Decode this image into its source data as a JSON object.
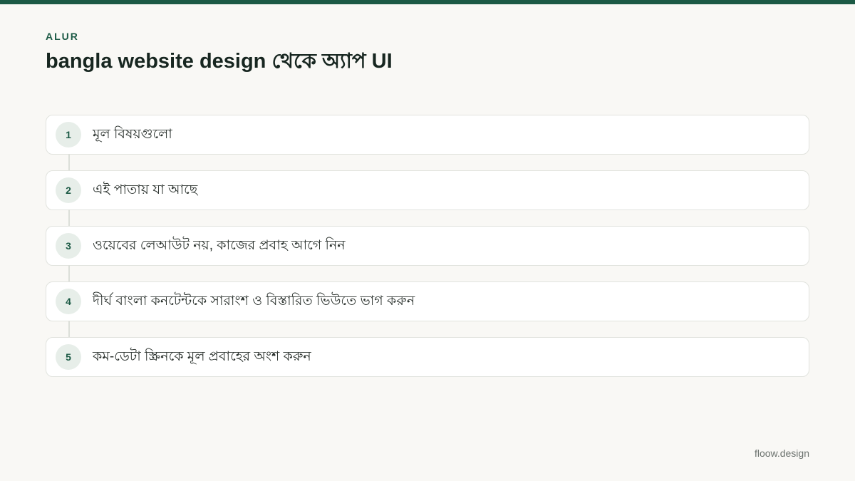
{
  "header": {
    "eyebrow": "ALUR",
    "title": "bangla website design থেকে অ্যাপ UI"
  },
  "steps": [
    {
      "number": "1",
      "label": "মূল বিষয়গুলো"
    },
    {
      "number": "2",
      "label": "এই পাতায় যা আছে"
    },
    {
      "number": "3",
      "label": "ওয়েবের লেআউট নয়, কাজের প্রবাহ আগে নিন"
    },
    {
      "number": "4",
      "label": "দীর্ঘ বাংলা কনটেন্টকে সারাংশ ও বিস্তারিত ভিউতে ভাগ করুন"
    },
    {
      "number": "5",
      "label": "কম-ডেটা স্ক্রিনকে মূল প্রবাহের অংশ করুন"
    }
  ],
  "footer": {
    "brand": "floow.design"
  },
  "colors": {
    "accent": "#1c5a45",
    "background": "#f9f8f5",
    "card_border": "#e1e3de",
    "badge_bg": "#e7eee9"
  }
}
